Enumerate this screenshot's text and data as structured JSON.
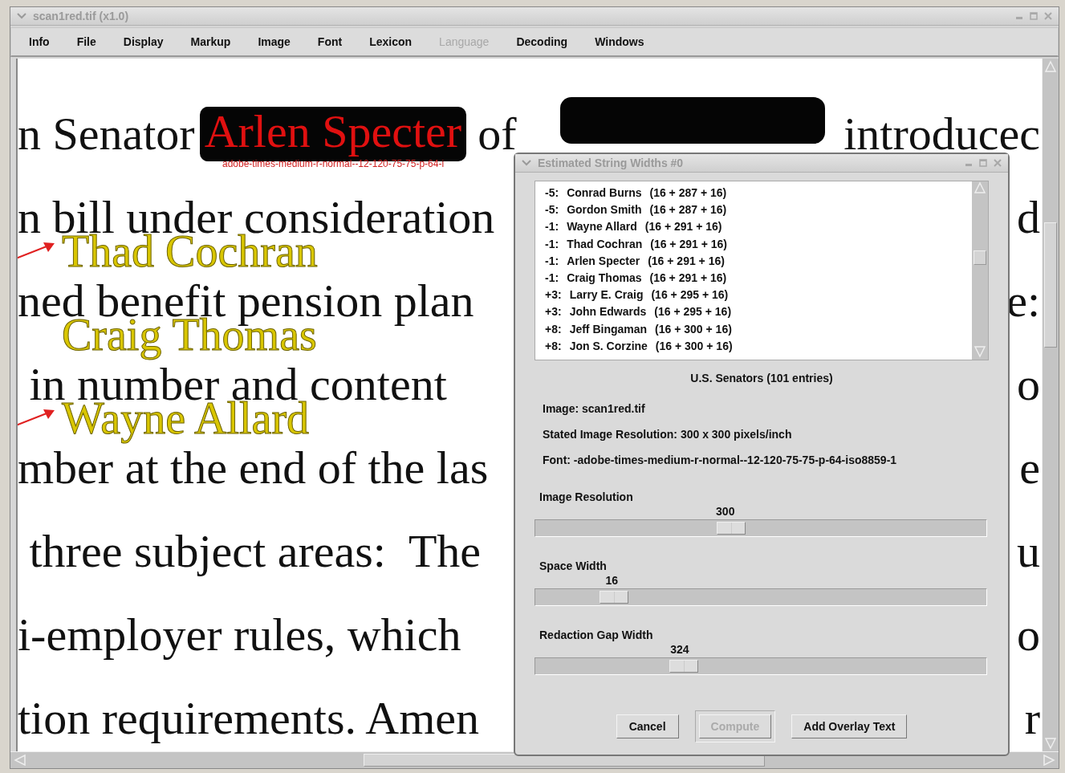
{
  "window": {
    "title": "scan1red.tif (x1.0)"
  },
  "menu": [
    {
      "label": "Info",
      "disabled": false
    },
    {
      "label": "File",
      "disabled": false
    },
    {
      "label": "Display",
      "disabled": false
    },
    {
      "label": "Markup",
      "disabled": false
    },
    {
      "label": "Image",
      "disabled": false
    },
    {
      "label": "Font",
      "disabled": false
    },
    {
      "label": "Lexicon",
      "disabled": false
    },
    {
      "label": "Language",
      "disabled": true
    },
    {
      "label": "Decoding",
      "disabled": false
    },
    {
      "label": "Windows",
      "disabled": false
    }
  ],
  "document": {
    "lines": [
      {
        "text": "n Senator",
        "redaction": {
          "text": "Arlen Specter",
          "font_label": "adobe-times-medium-r-normal--12-120-75-75-p-64-i"
        },
        "after": "of",
        "edge": "introducec"
      },
      {
        "text": "n bill under consideration",
        "edge": "d",
        "overlay": {
          "text": "Thad Cochran",
          "arrow": true
        }
      },
      {
        "text": "ned benefit pension plan",
        "edge": "e:",
        "overlay": {
          "text": "Craig Thomas",
          "arrow": false
        }
      },
      {
        "text": " in number and content",
        "edge": "o",
        "overlay": {
          "text": "Wayne Allard",
          "arrow": true
        }
      },
      {
        "text": "mber at the end of the las",
        "edge": "e"
      },
      {
        "text": " three subject areas:  The",
        "edge": "u"
      },
      {
        "text": "i-employer rules, which",
        "edge": "o"
      },
      {
        "text": "tion requirements. Amen",
        "edge": "r"
      }
    ]
  },
  "dialog": {
    "title": "Estimated String Widths #0",
    "entries": [
      {
        "offset": "-5:",
        "name": "Conrad Burns",
        "widths": "(16 + 287 + 16)"
      },
      {
        "offset": "-5:",
        "name": "Gordon Smith",
        "widths": "(16 + 287 + 16)"
      },
      {
        "offset": "-1:",
        "name": "Wayne Allard",
        "widths": "(16 + 291 + 16)"
      },
      {
        "offset": "-1:",
        "name": "Thad Cochran",
        "widths": "(16 + 291 + 16)"
      },
      {
        "offset": "-1:",
        "name": "Arlen Specter",
        "widths": "(16 + 291 + 16)"
      },
      {
        "offset": "-1:",
        "name": "Craig Thomas",
        "widths": "(16 + 291 + 16)"
      },
      {
        "offset": "+3:",
        "name": "Larry E. Craig",
        "widths": "(16 + 295 + 16)"
      },
      {
        "offset": "+3:",
        "name": "John Edwards",
        "widths": "(16 + 295 + 16)"
      },
      {
        "offset": "+8:",
        "name": "Jeff Bingaman",
        "widths": "(16 + 300 + 16)"
      },
      {
        "offset": "+8:",
        "name": "Jon S. Corzine",
        "widths": "(16 + 300 + 16)"
      }
    ],
    "list_caption": "U.S. Senators (101 entries)",
    "info": [
      "Image:  scan1red.tif",
      "Stated Image Resolution:  300 x 300 pixels/inch",
      "Font:  -adobe-times-medium-r-normal--12-120-75-75-p-64-iso8859-1"
    ],
    "sliders": [
      {
        "label": "Image Resolution",
        "reading": "300",
        "level": 0.435
      },
      {
        "label": "Space Width",
        "reading": "16",
        "level": 0.174
      },
      {
        "label": "Redaction Gap Width",
        "reading": "324",
        "level": 0.33
      }
    ],
    "buttons": [
      {
        "label": "Cancel",
        "disabled": false
      },
      {
        "label": "Compute",
        "disabled": true
      },
      {
        "label": "Add Overlay Text",
        "disabled": false
      }
    ]
  }
}
